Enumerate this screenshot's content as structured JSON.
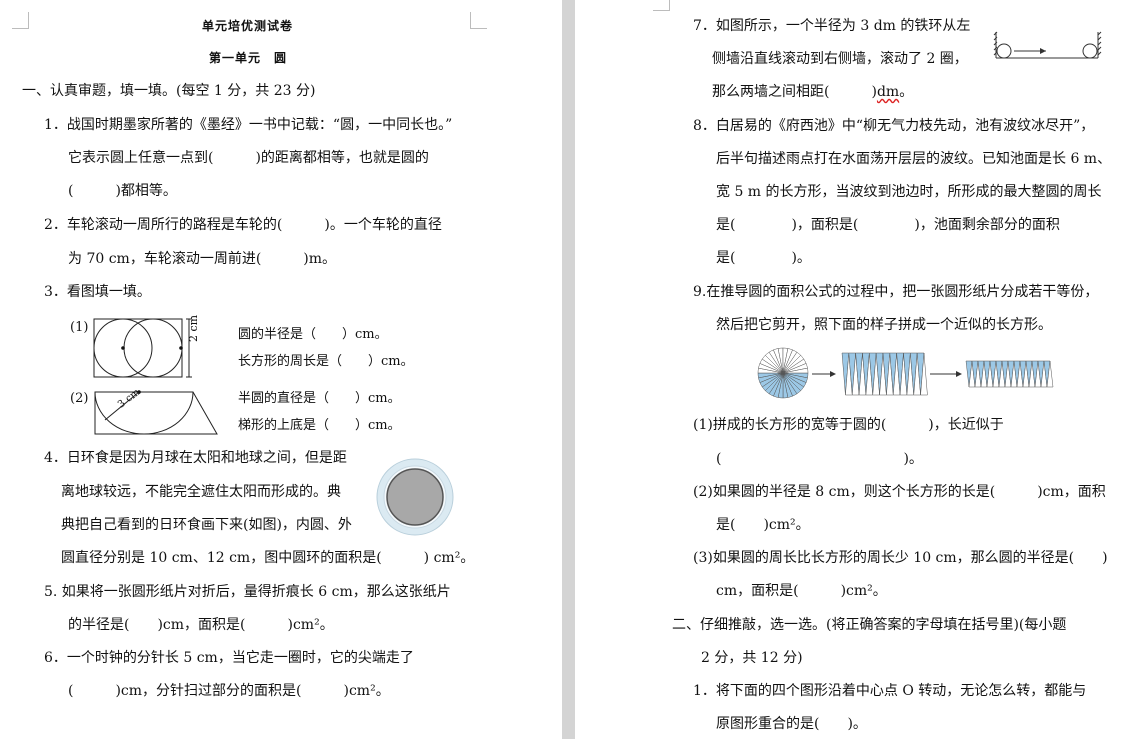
{
  "left": {
    "title": "单元培优测试卷",
    "unit": "第一单元　圆",
    "section1": "一、认真审题，填一填。(每空 1 分，共 23 分)",
    "q1": [
      "1．战国时期墨家所著的《墨经》一书中记载：“圆，一中同长也。”",
      "它表示圆上任意一点到(　　　)的距离都相等，也就是圆的",
      "(　　　)都相等。"
    ],
    "q2": [
      "2．车轮滚动一周所行的路程是车轮的(　　　)。一个车轮的直径",
      "为 70 cm，车轮滚动一周前进(　　　)m。"
    ],
    "q3": "3．看图填一填。",
    "q3_1": {
      "label": "(1)",
      "dim": "2 cm",
      "line1": "圆的半径是（　　）cm。",
      "line2": "长方形的周长是（　　）cm。"
    },
    "q3_2": {
      "label": "(2)",
      "dim": "3 cm",
      "line1": "半圆的直径是（　　）cm。",
      "line2": "梯形的上底是（　　）cm。"
    },
    "q4": [
      "4．日环食是因为月球在太阳和地球之间，但是距",
      "离地球较远，不能完全遮住太阳而形成的。典",
      "典把自己看到的日环食画下来(如图)，内圆、外",
      "圆直径分别是 10 cm、12 cm，图中圆环的面积是(　　　) cm²。"
    ],
    "q5": [
      "5. 如果将一张圆形纸片对折后，量得折痕长 6 cm，那么这张纸片",
      "的半径是(　　)cm，面积是(　　　)cm²。"
    ],
    "q6": [
      "6．一个时钟的分针长 5 cm，当它走一圈时，它的尖端走了",
      "(　　　)cm，分针扫过部分的面积是(　　　)cm²。"
    ]
  },
  "right": {
    "q7": {
      "line1": "7．如图所示，一个半径为 3 dm 的铁环从左",
      "line2": "侧墙沿直线滚动到右侧墙，滚动了 2 圈，",
      "line3_a": "那么两墙之间相距(　　　)",
      "line3_b": "dm",
      "line3_c": "。"
    },
    "q8": [
      "8．白居易的《府西池》中“柳无气力枝先动，池有波纹冰尽开”，",
      "后半句描述雨点打在水面荡开层层的波纹。已知池面是长 6 m、",
      "宽 5 m 的长方形，当波纹到池边时，所形成的最大整圆的周长",
      "是(　　　　)，面积是(　　　　)，池面剩余部分的面积",
      "是(　　　　)。"
    ],
    "q9": [
      "9.在推导圆的面积公式的过程中，把一张圆形纸片分成若干等份，",
      "然后把它剪开，照下面的样子拼成一个近似的长方形。"
    ],
    "q9_1": [
      "(1)拼成的长方形的宽等于圆的(　　　)，长近似于",
      "(　　　　　　　　　　　　　)。"
    ],
    "q9_2": [
      "(2)如果圆的半径是 8 cm，则这个长方形的长是(　　　)cm，面积",
      "是(　　)cm²。"
    ],
    "q9_3": [
      "(3)如果圆的周长比长方形的周长少 10 cm，那么圆的半径是(　　)",
      "cm，面积是(　　　)cm²。"
    ],
    "section2": [
      "二、仔细推敲，选一选。(将正确答案的字母填在括号里)(每小题",
      "2 分，共 12 分)"
    ],
    "s2q1": [
      "1．将下面的四个图形沿着中心点 O 转动，无论怎么转，都能与",
      "原图形重合的是(　　)。"
    ]
  },
  "colors": {
    "page": "#ffffff",
    "background": "#e5e5e5",
    "ring_fill": "#a8a8a8",
    "ring_outer": "#dbeaf2",
    "fan_blue": "#9cc8e6"
  }
}
